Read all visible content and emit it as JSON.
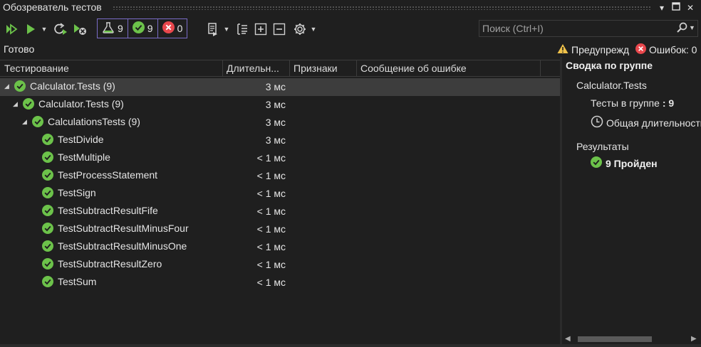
{
  "window": {
    "title": "Обозреватель тестов"
  },
  "toolbar": {
    "counters": {
      "total": "9",
      "passed": "9",
      "failed": "0"
    }
  },
  "search": {
    "placeholder": "Поиск (Ctrl+I)"
  },
  "status": {
    "text": "Готово",
    "warnings_label": "Предупрежд",
    "errors_label": "Ошибок: 0"
  },
  "columns": [
    "Тестирование",
    "Длительн...",
    "Признаки",
    "Сообщение об ошибке"
  ],
  "rows": [
    {
      "name": "Calculator.Tests",
      "count": "(9)",
      "duration": "3 мс"
    },
    {
      "name": "Calculator.Tests",
      "count": "(9)",
      "duration": "3 мс"
    },
    {
      "name": "CalculationsTests",
      "count": "(9)",
      "duration": "3 мс"
    },
    {
      "name": "TestDivide",
      "duration": "3 мс"
    },
    {
      "name": "TestMultiple",
      "duration": "< 1 мс"
    },
    {
      "name": "TestProcessStatement",
      "duration": "< 1 мс"
    },
    {
      "name": "TestSign",
      "duration": "< 1 мс"
    },
    {
      "name": "TestSubtractResultFife",
      "duration": "< 1 мс"
    },
    {
      "name": "TestSubtractResultMinusFour",
      "duration": "< 1 мс"
    },
    {
      "name": "TestSubtractResultMinusOne",
      "duration": "< 1 мс"
    },
    {
      "name": "TestSubtractResultZero",
      "duration": "< 1 мс"
    },
    {
      "name": "TestSum",
      "duration": "< 1 мс"
    }
  ],
  "summary": {
    "title": "Сводка по группе",
    "group_name": "Calculator.Tests",
    "tests_in_group_label": "Тесты в группе",
    "tests_in_group_value": "9",
    "total_duration_label": "Общая длительность",
    "results_label": "Результаты",
    "passed_text": "9 Пройден"
  },
  "colors": {
    "accent": "#7a6cc7",
    "pass": "#6cc24a",
    "fail": "#e8474c",
    "warn": "#f0c24a"
  }
}
